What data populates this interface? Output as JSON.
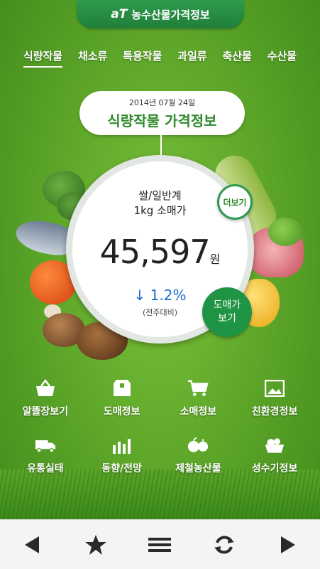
{
  "header": {
    "logo": "aT",
    "title": "농수산물가격정보"
  },
  "category_tabs": [
    {
      "label": "식량작물",
      "active": true
    },
    {
      "label": "채소류",
      "active": false
    },
    {
      "label": "특용작물",
      "active": false
    },
    {
      "label": "과일류",
      "active": false
    },
    {
      "label": "축산물",
      "active": false
    },
    {
      "label": "수산물",
      "active": false
    }
  ],
  "summary": {
    "date": "2014년 07월 24일",
    "title": "식량작물 가격정보",
    "item_line1": "쌀/일반계",
    "item_line2": "1kg 소매가",
    "price": "45,597",
    "price_unit": "원",
    "change_arrow": "↓",
    "change": "1.2%",
    "change_note": "(전주대비)",
    "more_label": "더보기",
    "wholesale_line1": "도매가",
    "wholesale_line2": "보기"
  },
  "shortcuts": [
    {
      "label": "알뜰장보기",
      "icon": "basket-icon"
    },
    {
      "label": "도매정보",
      "icon": "box-icon"
    },
    {
      "label": "소매정보",
      "icon": "cart-icon"
    },
    {
      "label": "친환경정보",
      "icon": "landscape-icon"
    },
    {
      "label": "유통실태",
      "icon": "truck-icon"
    },
    {
      "label": "동향/전망",
      "icon": "bar-chart-icon"
    },
    {
      "label": "제철농산물",
      "icon": "fruit-icon"
    },
    {
      "label": "성수기정보",
      "icon": "produce-basket-icon"
    }
  ],
  "bottom_nav": [
    {
      "icon": "back-arrow-icon"
    },
    {
      "icon": "star-icon"
    },
    {
      "icon": "menu-icon"
    },
    {
      "icon": "refresh-icon"
    },
    {
      "icon": "forward-arrow-icon"
    }
  ],
  "colors": {
    "brand_green": "#2f9a4d",
    "change_blue": "#1e6fcf"
  }
}
